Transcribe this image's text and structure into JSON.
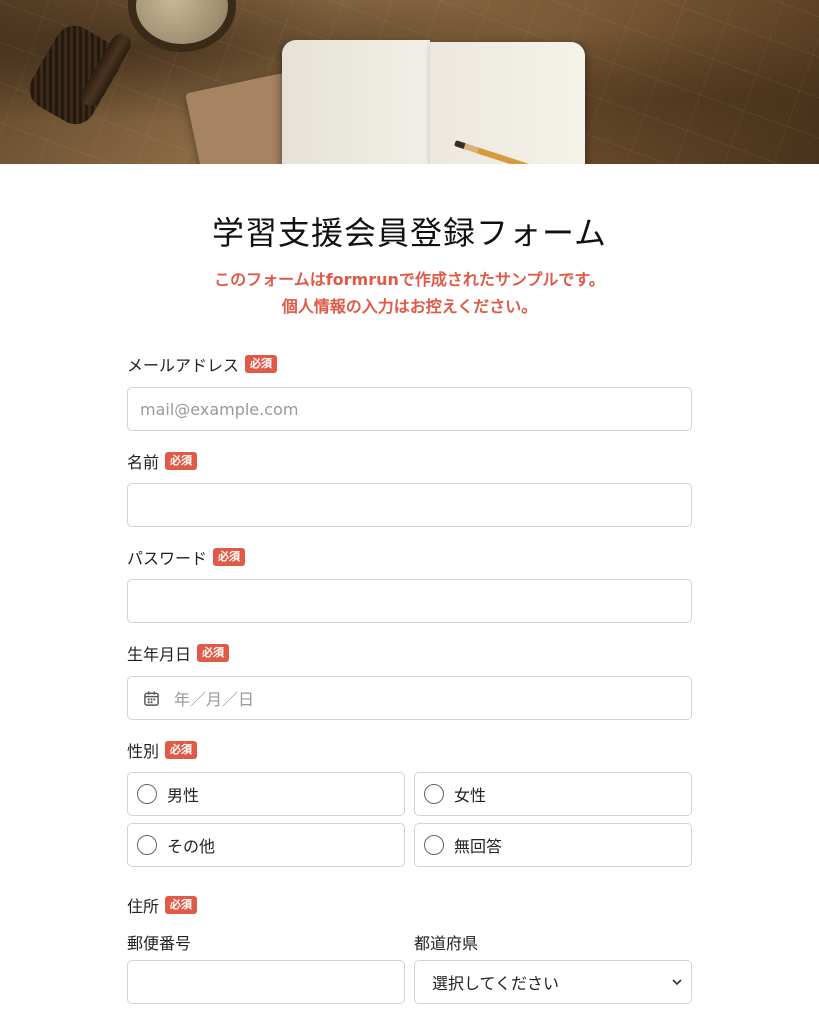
{
  "form": {
    "title": "学習支援会員登録フォーム",
    "notice_line1": "このフォームはformrunで作成されたサンプルです。",
    "notice_line2": "個人情報の入力はお控えください。",
    "required_badge": "必須"
  },
  "fields": {
    "email": {
      "label": "メールアドレス",
      "placeholder": "mail@example.com",
      "value": ""
    },
    "name": {
      "label": "名前",
      "value": ""
    },
    "password": {
      "label": "パスワード",
      "value": ""
    },
    "birthdate": {
      "label": "生年月日",
      "placeholder": "年／月／日"
    },
    "gender": {
      "label": "性別",
      "options": [
        "男性",
        "女性",
        "その他",
        "無回答"
      ]
    },
    "address": {
      "label": "住所",
      "postal_label": "郵便番号",
      "prefecture_label": "都道府県",
      "prefecture_selected": "選択してください"
    }
  },
  "colors": {
    "accent": "#e05a47",
    "border": "#cfd4da"
  }
}
